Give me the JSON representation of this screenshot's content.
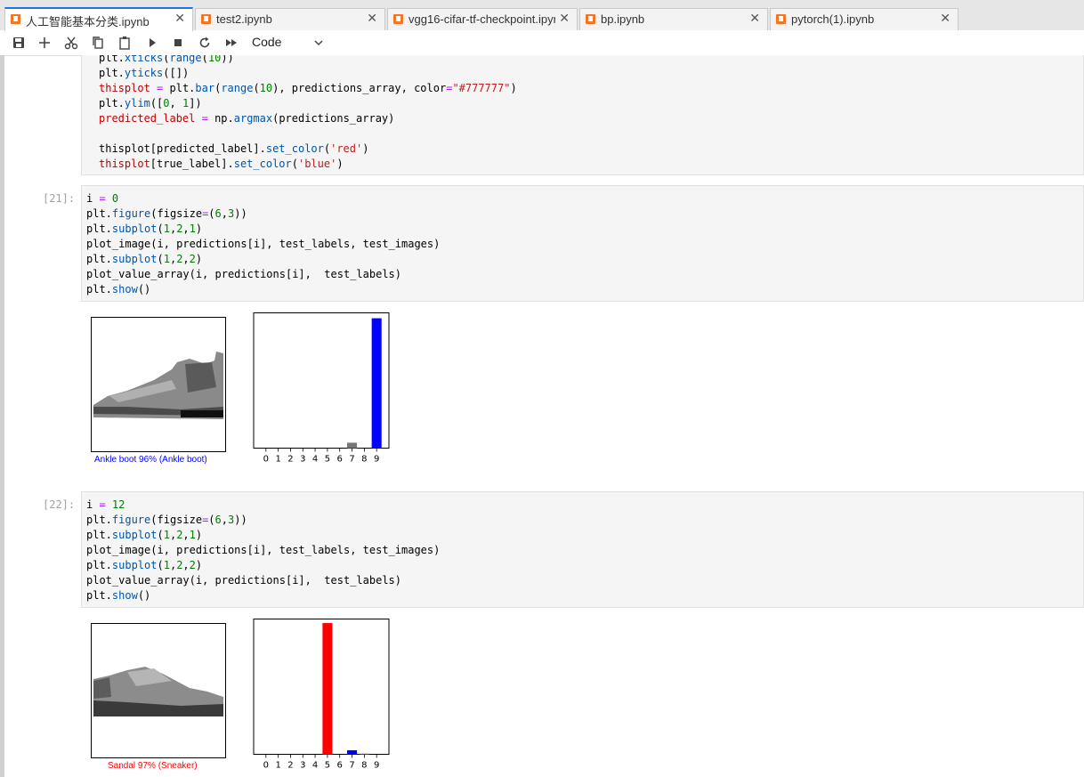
{
  "tabs": [
    {
      "label": "人工智能基本分类.ipynb",
      "active": true
    },
    {
      "label": "test2.ipynb",
      "active": false
    },
    {
      "label": "vgg16-cifar-tf-checkpoint.ipynb",
      "active": false
    },
    {
      "label": "bp.ipynb",
      "active": false
    },
    {
      "label": "pytorch(1).ipynb",
      "active": false
    }
  ],
  "toolbar": {
    "icons": [
      "save-icon",
      "add-icon",
      "cut-icon",
      "copy-icon",
      "paste-icon",
      "run-icon",
      "stop-icon",
      "restart-icon",
      "fast-forward-icon"
    ],
    "cell_type": "Code"
  },
  "cell0": {
    "lines": [
      "plt.xticks(range(10))",
      "plt.yticks([])",
      "thisplot = plt.bar(range(10), predictions_array, color=\"#777777\")",
      "plt.ylim([0, 1])",
      "predicted_label = np.argmax(predictions_array)",
      "",
      "thisplot[predicted_label].set_color('red')",
      "thisplot[true_label].set_color('blue')"
    ]
  },
  "cell21": {
    "prompt": "[21]:",
    "lines": [
      "i = 0",
      "plt.figure(figsize=(6,3))",
      "plt.subplot(1,2,1)",
      "plot_image(i, predictions[i], test_labels, test_images)",
      "plt.subplot(1,2,2)",
      "plot_value_array(i, predictions[i],  test_labels)",
      "plt.show()"
    ],
    "caption": "Ankle boot 96% (Ankle boot)",
    "caption_color": "#0000ff"
  },
  "cell22": {
    "prompt": "[22]:",
    "lines": [
      "i = 12",
      "plt.figure(figsize=(6,3))",
      "plt.subplot(1,2,1)",
      "plot_image(i, predictions[i], test_labels, test_images)",
      "plt.subplot(1,2,2)",
      "plot_value_array(i, predictions[i],  test_labels)",
      "plt.show()"
    ],
    "caption": "Sandal 97% (Sneaker)",
    "caption_color": "#ff0000"
  },
  "chart_data": [
    {
      "type": "bar",
      "categories": [
        "0",
        "1",
        "2",
        "3",
        "4",
        "5",
        "6",
        "7",
        "8",
        "9"
      ],
      "values": [
        0,
        0,
        0,
        0,
        0,
        0,
        0,
        0.04,
        0,
        0.96
      ],
      "colors": [
        "#777777",
        "#777777",
        "#777777",
        "#777777",
        "#777777",
        "#777777",
        "#777777",
        "#777777",
        "#777777",
        "#0000ff"
      ],
      "ylim": [
        0,
        1
      ]
    },
    {
      "type": "bar",
      "categories": [
        "0",
        "1",
        "2",
        "3",
        "4",
        "5",
        "6",
        "7",
        "8",
        "9"
      ],
      "values": [
        0,
        0,
        0,
        0,
        0,
        0.97,
        0,
        0.03,
        0.005,
        0
      ],
      "colors": [
        "#777777",
        "#777777",
        "#777777",
        "#777777",
        "#777777",
        "#ff0000",
        "#777777",
        "#0000ff",
        "#777777",
        "#777777"
      ],
      "ylim": [
        0,
        1
      ]
    }
  ]
}
